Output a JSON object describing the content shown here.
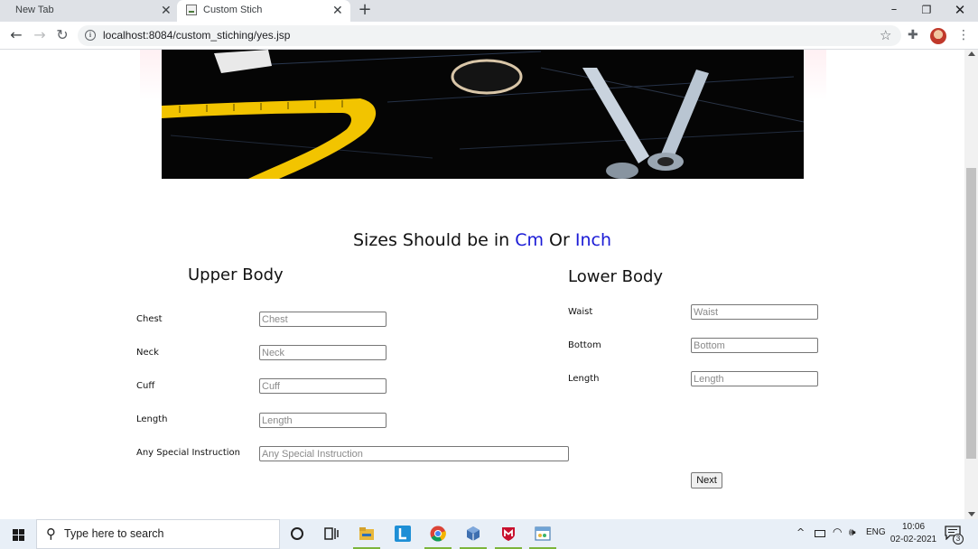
{
  "browser": {
    "tabs": [
      {
        "title": "New Tab",
        "close": "✕"
      },
      {
        "title": "Custom Stich",
        "close": "✕"
      }
    ],
    "new_tab": "+",
    "window_controls": {
      "minimize": "–",
      "restore": "❐",
      "close": "✕"
    },
    "address": {
      "url": "localhost:8084/custom_stiching/yes.jsp",
      "info_icon": "i"
    },
    "toolbar_icons": {
      "back": "←",
      "forward": "→",
      "reload": "↻",
      "star": "☆",
      "extensions": "✚",
      "menu": "⋮"
    }
  },
  "page": {
    "heading": {
      "prefix": "Sizes Should be in ",
      "unit1": "Cm",
      "middle": " Or ",
      "unit2": "Inch"
    },
    "unit_color": "#1a1ad6",
    "upper_body": {
      "title": "Upper Body",
      "fields": [
        {
          "label": "Chest",
          "placeholder": "Chest",
          "value": ""
        },
        {
          "label": "Neck",
          "placeholder": "Neck",
          "value": ""
        },
        {
          "label": "Cuff",
          "placeholder": "Cuff",
          "value": ""
        },
        {
          "label": "Length",
          "placeholder": "Length",
          "value": ""
        }
      ],
      "special": {
        "label": "Any Special Instruction",
        "placeholder": "Any Special Instruction",
        "value": ""
      }
    },
    "lower_body": {
      "title": "Lower Body",
      "fields": [
        {
          "label": "Waist",
          "placeholder": "Waist",
          "value": ""
        },
        {
          "label": "Bottom",
          "placeholder": "Bottom",
          "value": ""
        },
        {
          "label": "Length",
          "placeholder": "Length",
          "value": ""
        }
      ]
    },
    "next_button": "Next"
  },
  "taskbar": {
    "search_placeholder": "Type here to search",
    "search_icon": "⚲",
    "tray": {
      "up_arrow": "^",
      "wifi": "◠",
      "volume": "🕪",
      "language": "ENG",
      "time": "10:06",
      "date": "02-02-2021",
      "notification_count": "3"
    },
    "icons": [
      "cortana-icon",
      "task-view-icon",
      "file-explorer-icon",
      "l-app-icon",
      "chrome-icon",
      "package-icon",
      "mcafee-icon",
      "paint-icon"
    ]
  }
}
